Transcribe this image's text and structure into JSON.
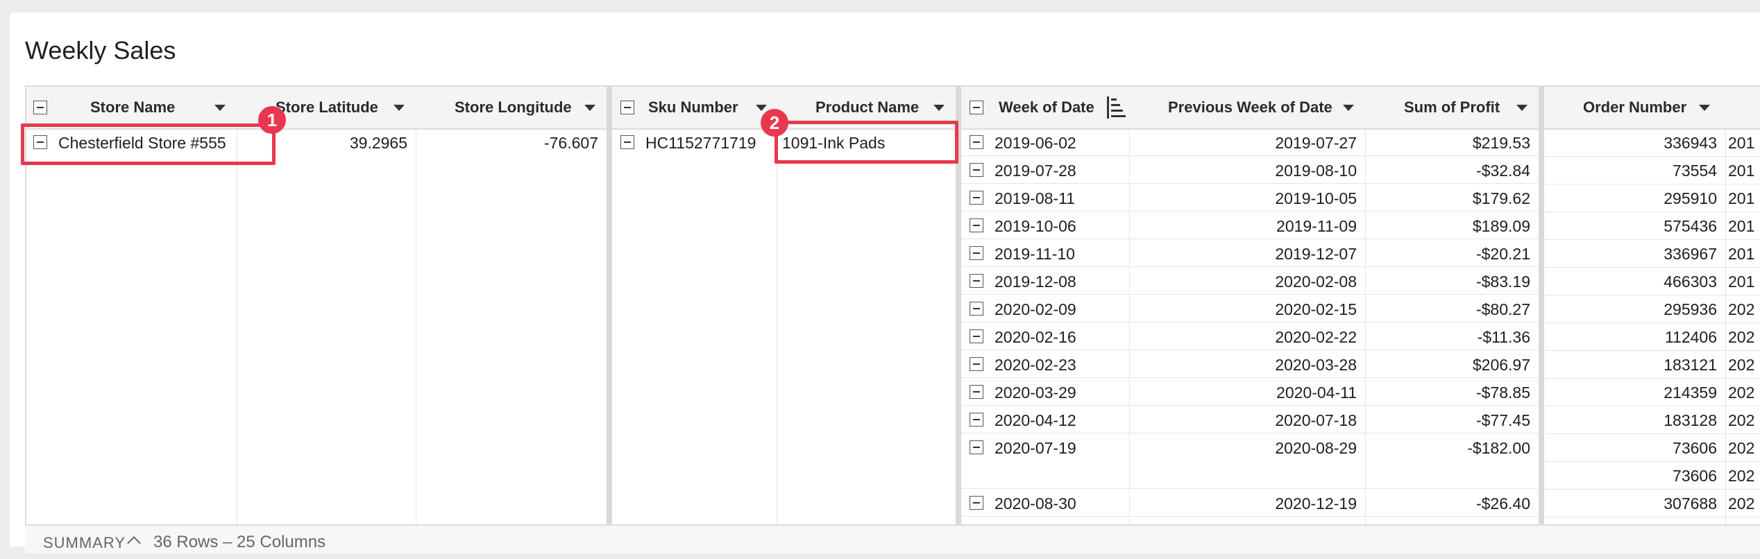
{
  "page": {
    "title": "Weekly Sales"
  },
  "columns": {
    "store_name": "Store Name",
    "store_latitude": "Store Latitude",
    "store_longitude": "Store Longitude",
    "sku_number": "Sku Number",
    "product_name": "Product Name",
    "week_of_date": "Week of Date",
    "prev_week": "Previous Week of Date",
    "sum_profit": "Sum of Profit",
    "order_number": "Order Number"
  },
  "group1": {
    "store_name": "Chesterfield Store #555",
    "store_latitude": "39.2965",
    "store_longitude": "-76.607"
  },
  "group2": {
    "sku_number": "HC1152771719",
    "product_name": "1091-Ink Pads"
  },
  "rows": [
    {
      "week": "2019-06-02",
      "prev": "2019-07-27",
      "profit": "$219.53",
      "orders": [
        "336943"
      ],
      "last": [
        "201"
      ]
    },
    {
      "week": "2019-07-28",
      "prev": "2019-08-10",
      "profit": "-$32.84",
      "orders": [
        "73554"
      ],
      "last": [
        "201"
      ]
    },
    {
      "week": "2019-08-11",
      "prev": "2019-10-05",
      "profit": "$179.62",
      "orders": [
        "295910"
      ],
      "last": [
        "201"
      ]
    },
    {
      "week": "2019-10-06",
      "prev": "2019-11-09",
      "profit": "$189.09",
      "orders": [
        "575436"
      ],
      "last": [
        "201"
      ]
    },
    {
      "week": "2019-11-10",
      "prev": "2019-12-07",
      "profit": "-$20.21",
      "orders": [
        "336967"
      ],
      "last": [
        "201"
      ]
    },
    {
      "week": "2019-12-08",
      "prev": "2020-02-08",
      "profit": "-$83.19",
      "orders": [
        "466303"
      ],
      "last": [
        "201"
      ]
    },
    {
      "week": "2020-02-09",
      "prev": "2020-02-15",
      "profit": "-$80.27",
      "orders": [
        "295936"
      ],
      "last": [
        "202"
      ]
    },
    {
      "week": "2020-02-16",
      "prev": "2020-02-22",
      "profit": "-$11.36",
      "orders": [
        "112406"
      ],
      "last": [
        "202"
      ]
    },
    {
      "week": "2020-02-23",
      "prev": "2020-03-28",
      "profit": "$206.97",
      "orders": [
        "183121"
      ],
      "last": [
        "202"
      ]
    },
    {
      "week": "2020-03-29",
      "prev": "2020-04-11",
      "profit": "-$78.85",
      "orders": [
        "214359"
      ],
      "last": [
        "202"
      ]
    },
    {
      "week": "2020-04-12",
      "prev": "2020-07-18",
      "profit": "-$77.45",
      "orders": [
        "183128"
      ],
      "last": [
        "202"
      ]
    },
    {
      "week": "2020-07-19",
      "prev": "2020-08-29",
      "profit": "-$182.00",
      "orders": [
        "73606",
        "73606"
      ],
      "last": [
        "202",
        "202"
      ]
    },
    {
      "week": "2020-08-30",
      "prev": "2020-12-19",
      "profit": "-$26.40",
      "orders": [
        "307688"
      ],
      "last": [
        "202"
      ]
    }
  ],
  "annotations": {
    "badge1": "1",
    "badge2": "2"
  },
  "summary": {
    "label": "SUMMARY",
    "counts": "36 Rows – 25 Columns"
  },
  "colors": {
    "highlight": "#e8384f",
    "header_bg": "#f4f4f4"
  },
  "icons": [
    "collapse-icon",
    "caret-down-icon",
    "sort-ascending-icon",
    "chevron-up-icon"
  ]
}
